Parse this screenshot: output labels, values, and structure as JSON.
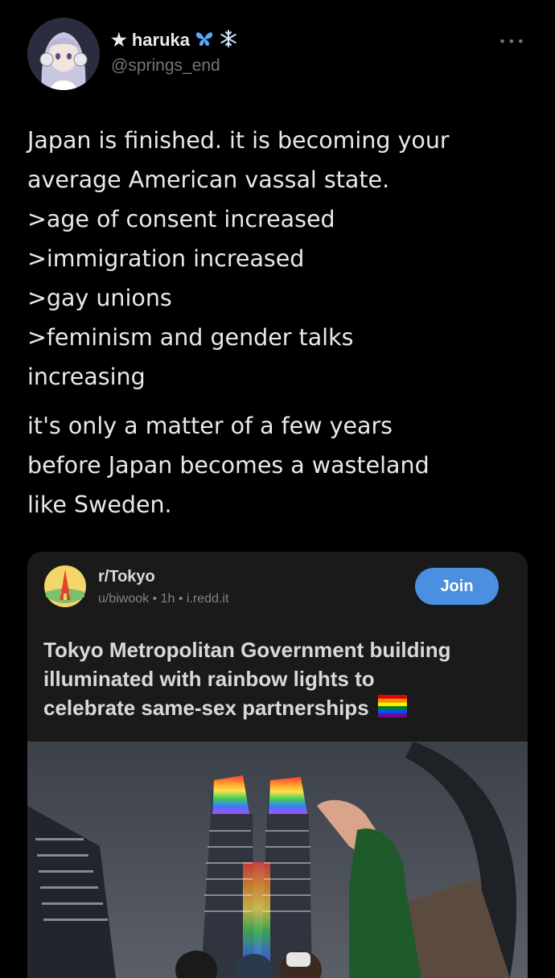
{
  "tweet": {
    "author_name": "★ haruka",
    "author_handle": "@springs_end",
    "more_icon": "more-dots-icon",
    "text_lines": [
      "Japan is finished. it is becoming your",
      "average American vassal state.",
      ">age of consent increased",
      ">immigration increased",
      ">gay unions",
      ">feminism and gender talks",
      "increasing"
    ],
    "text_lines_2": [
      "it's only a matter of a few years",
      "before Japan becomes a wasteland",
      "like Sweden."
    ]
  },
  "embed": {
    "subreddit": "r/Tokyo",
    "meta": "u/biwook • 1h • i.redd.it",
    "join_label": "Join",
    "title_lines": [
      "Tokyo Metropolitan Government building",
      "illuminated with rainbow lights to",
      "celebrate same-sex partnerships"
    ],
    "accent": "#4a8fe0"
  }
}
